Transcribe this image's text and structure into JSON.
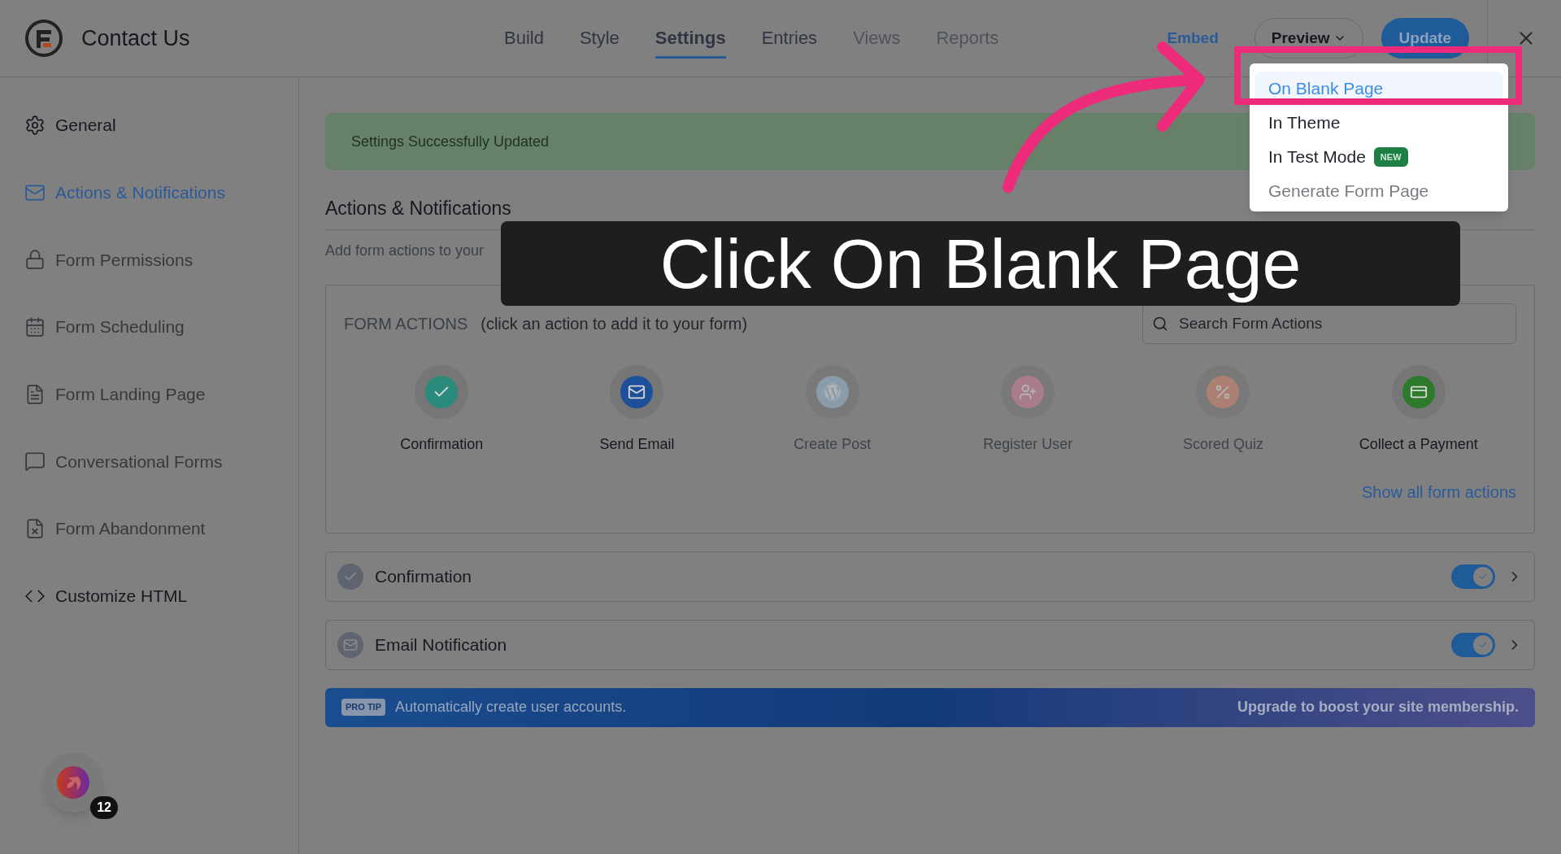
{
  "header": {
    "title": "Contact Us",
    "tabs": [
      {
        "label": "Build",
        "selected": false,
        "disabled": false
      },
      {
        "label": "Style",
        "selected": false,
        "disabled": false
      },
      {
        "label": "Settings",
        "selected": true,
        "disabled": false
      },
      {
        "label": "Entries",
        "selected": false,
        "disabled": false
      },
      {
        "label": "Views",
        "selected": false,
        "disabled": true
      },
      {
        "label": "Reports",
        "selected": false,
        "disabled": true
      }
    ],
    "embed": "Embed",
    "preview": "Preview",
    "update": "Update"
  },
  "preview_menu": {
    "items": [
      {
        "label": "On Blank Page",
        "selected": true,
        "disabled": false
      },
      {
        "label": "In Theme",
        "selected": false,
        "disabled": false
      },
      {
        "label": "In Test Mode",
        "selected": false,
        "disabled": false,
        "badge": "NEW"
      },
      {
        "label": "Generate Form Page",
        "selected": false,
        "disabled": true
      }
    ]
  },
  "sidebar": {
    "items": [
      {
        "label": "General",
        "selected": false,
        "disabled": false
      },
      {
        "label": "Actions & Notifications",
        "selected": true,
        "disabled": false
      },
      {
        "label": "Form Permissions",
        "selected": false,
        "disabled": true
      },
      {
        "label": "Form Scheduling",
        "selected": false,
        "disabled": true
      },
      {
        "label": "Form Landing Page",
        "selected": false,
        "disabled": true
      },
      {
        "label": "Conversational Forms",
        "selected": false,
        "disabled": true
      },
      {
        "label": "Form Abandonment",
        "selected": false,
        "disabled": true
      },
      {
        "label": "Customize HTML",
        "selected": false,
        "disabled": false
      }
    ],
    "notification_count": "12"
  },
  "alert": "Settings Successfully Updated",
  "section": {
    "title": "Actions & Notifications",
    "description": "Add form actions to your"
  },
  "form_actions": {
    "title": "FORM ACTIONS",
    "hint": "(click an action to add it to your form)",
    "search_placeholder": "Search Form Actions",
    "actions": [
      {
        "label": "Confirmation",
        "disabled": false
      },
      {
        "label": "Send Email",
        "disabled": false
      },
      {
        "label": "Create Post",
        "disabled": true
      },
      {
        "label": "Register User",
        "disabled": true
      },
      {
        "label": "Scored Quiz",
        "disabled": true
      },
      {
        "label": "Collect a Payment",
        "disabled": false
      }
    ],
    "show_all": "Show all form actions"
  },
  "actions_list": [
    {
      "label": "Confirmation",
      "on": true
    },
    {
      "label": "Email Notification",
      "on": true
    }
  ],
  "pro_tip": {
    "badge": "PRO TIP",
    "text": "Automatically create user accounts.",
    "link": "Upgrade to boost your site membership."
  },
  "annotation": {
    "caption": "Click On Blank Page"
  }
}
